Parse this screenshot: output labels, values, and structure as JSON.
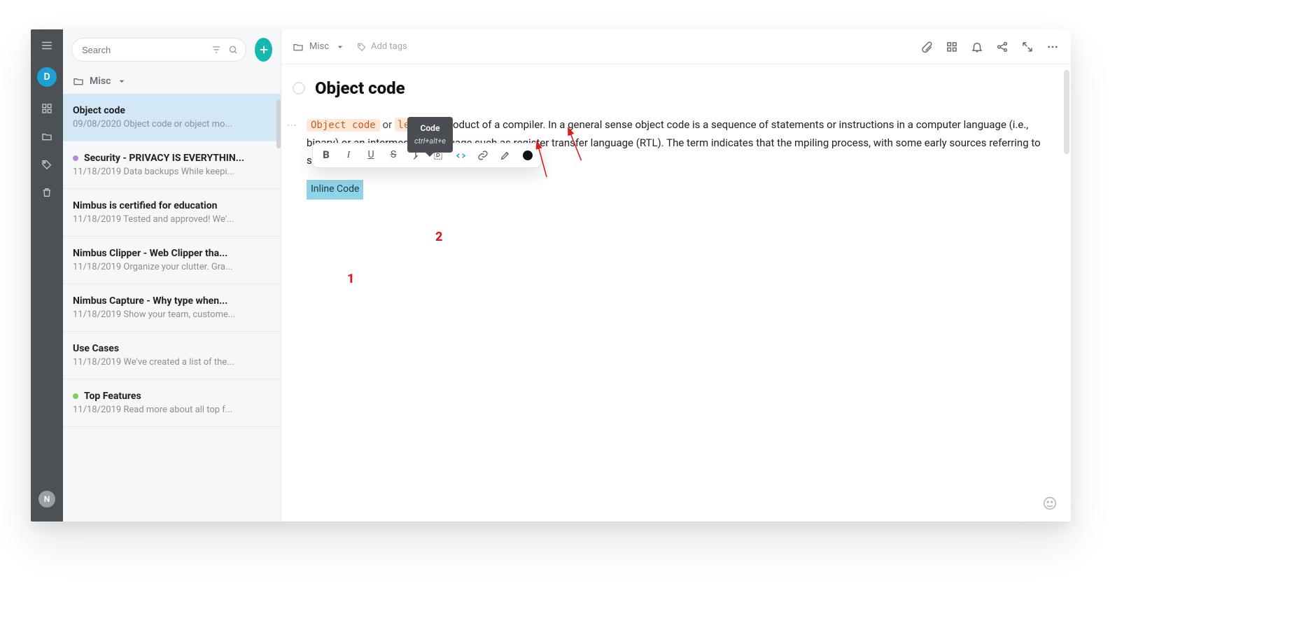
{
  "rail": {
    "avatar_letter": "D",
    "footer_letter": "N"
  },
  "search": {
    "placeholder": "Search"
  },
  "folder": {
    "name": "Misc"
  },
  "notes": [
    {
      "title": "Object code",
      "date": "09/08/2020",
      "snippet": "Object code or object mo...",
      "selected": true,
      "dot": null
    },
    {
      "title": "Security - PRIVACY IS EVERYTHIN...",
      "date": "11/18/2019",
      "snippet": "Data backups While keepi...",
      "selected": false,
      "dot": "#b18dd8"
    },
    {
      "title": "Nimbus is certified for education",
      "date": "11/18/2019",
      "snippet": "Tested and approved! We'...",
      "selected": false,
      "dot": null
    },
    {
      "title": "Nimbus Clipper - Web Clipper tha...",
      "date": "11/18/2019",
      "snippet": "Organize your clutter. Gra...",
      "selected": false,
      "dot": null
    },
    {
      "title": "Nimbus Capture - Why type when...",
      "date": "11/18/2019",
      "snippet": "Show your team, custome...",
      "selected": false,
      "dot": null
    },
    {
      "title": "Use Cases",
      "date": "11/18/2019",
      "snippet": "We've created a list of the...",
      "selected": false,
      "dot": null
    },
    {
      "title": "Top Features",
      "date": "11/18/2019",
      "snippet": "Read more about all top f...",
      "selected": false,
      "dot": "#7fcf5a"
    }
  ],
  "header": {
    "breadcrumb": "Misc",
    "tags_label": "Add tags"
  },
  "page": {
    "title": "Object code",
    "code_chip1": "Object code",
    "or": "or",
    "orange_fragment": "le",
    "paragraph_rest": " is the product of a compiler. In a general sense object code is a sequence of statements or instructions in a computer language (i.e., binary) or an intermediate language such as register transfer language (RTL). The term indicates that the mpiling process, with some early sources referring to source code as a \"subject program.\"",
    "inline_code_sel": "Inline Code"
  },
  "toolbar": {
    "tooltip_title": "Code",
    "tooltip_shortcut": "ctrl+alt+e"
  },
  "annotations": {
    "label1": "1",
    "label2": "2"
  }
}
